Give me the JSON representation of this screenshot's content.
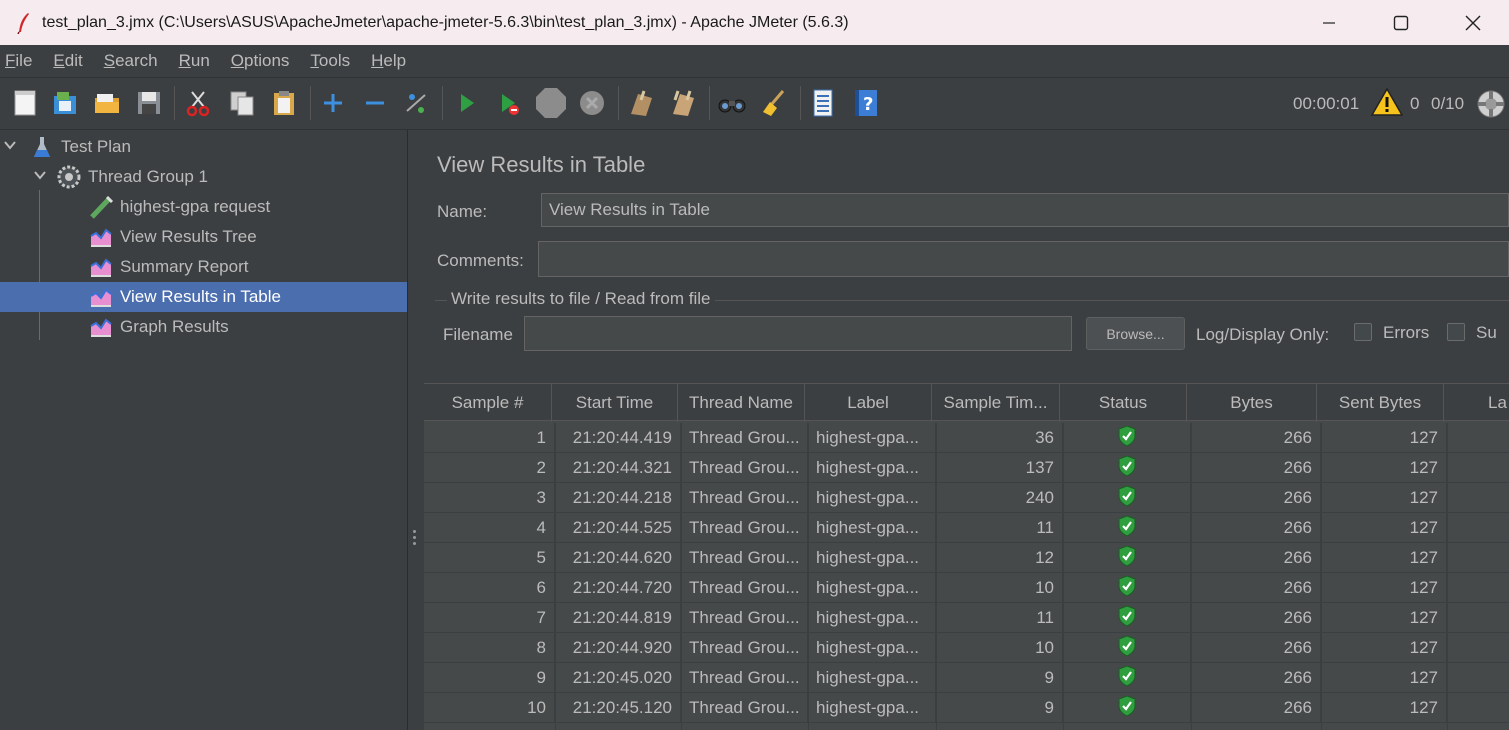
{
  "window": {
    "title": "test_plan_3.jmx (C:\\Users\\ASUS\\ApacheJmeter\\apache-jmeter-5.6.3\\bin\\test_plan_3.jmx) - Apache JMeter (5.6.3)"
  },
  "menu": [
    {
      "mnemonic": "F",
      "rest": "ile"
    },
    {
      "mnemonic": "E",
      "rest": "dit"
    },
    {
      "mnemonic": "S",
      "rest": "earch"
    },
    {
      "mnemonic": "R",
      "rest": "un"
    },
    {
      "mnemonic": "O",
      "rest": "ptions"
    },
    {
      "mnemonic": "T",
      "rest": "ools"
    },
    {
      "mnemonic": "H",
      "rest": "elp"
    }
  ],
  "toolbar": {
    "timer": "00:00:01",
    "warning_count": "0",
    "threads": "0/10"
  },
  "tree": {
    "test_plan": "Test Plan",
    "thread_group": "Thread Group 1",
    "items": [
      "highest-gpa request",
      "View Results Tree",
      "Summary Report",
      "View Results in Table",
      "Graph Results"
    ]
  },
  "panel": {
    "title": "View Results in Table",
    "name_label": "Name:",
    "name_value": "View Results in Table",
    "comments_label": "Comments:",
    "comments_value": "",
    "file_section": "Write results to file / Read from file",
    "filename_label": "Filename",
    "filename_value": "",
    "browse": "Browse...",
    "log_display": "Log/Display Only:",
    "errors": "Errors",
    "successes": "Su"
  },
  "table": {
    "headers": [
      "Sample #",
      "Start Time",
      "Thread Name",
      "Label",
      "Sample Tim...",
      "Status",
      "Bytes",
      "Sent Bytes",
      "La"
    ],
    "rows": [
      [
        "1",
        "21:20:44.419",
        "Thread Grou...",
        "highest-gpa...",
        "36",
        "success",
        "266",
        "127"
      ],
      [
        "2",
        "21:20:44.321",
        "Thread Grou...",
        "highest-gpa...",
        "137",
        "success",
        "266",
        "127"
      ],
      [
        "3",
        "21:20:44.218",
        "Thread Grou...",
        "highest-gpa...",
        "240",
        "success",
        "266",
        "127"
      ],
      [
        "4",
        "21:20:44.525",
        "Thread Grou...",
        "highest-gpa...",
        "11",
        "success",
        "266",
        "127"
      ],
      [
        "5",
        "21:20:44.620",
        "Thread Grou...",
        "highest-gpa...",
        "12",
        "success",
        "266",
        "127"
      ],
      [
        "6",
        "21:20:44.720",
        "Thread Grou...",
        "highest-gpa...",
        "10",
        "success",
        "266",
        "127"
      ],
      [
        "7",
        "21:20:44.819",
        "Thread Grou...",
        "highest-gpa...",
        "11",
        "success",
        "266",
        "127"
      ],
      [
        "8",
        "21:20:44.920",
        "Thread Grou...",
        "highest-gpa...",
        "10",
        "success",
        "266",
        "127"
      ],
      [
        "9",
        "21:20:45.020",
        "Thread Grou...",
        "highest-gpa...",
        "9",
        "success",
        "266",
        "127"
      ],
      [
        "10",
        "21:20:45.120",
        "Thread Grou...",
        "highest-gpa...",
        "9",
        "success",
        "266",
        "127"
      ]
    ]
  },
  "colors": {
    "selection": "#4b6eaf",
    "background": "#3c3f41",
    "success": "#2e9e3e"
  }
}
